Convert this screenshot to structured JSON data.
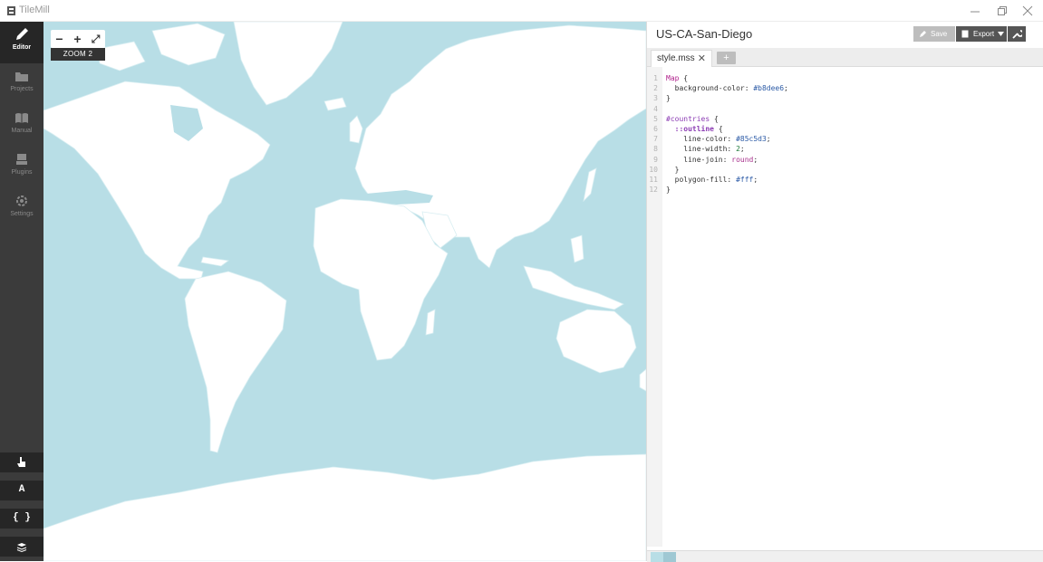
{
  "window": {
    "title": "TileMill",
    "controls": [
      "minimize",
      "maximize",
      "close"
    ]
  },
  "sidebar": {
    "items": [
      {
        "label": "Editor",
        "icon": "pencil-icon",
        "active": true
      },
      {
        "label": "Projects",
        "icon": "folder-icon",
        "active": false
      },
      {
        "label": "Manual",
        "icon": "book-icon",
        "active": false
      },
      {
        "label": "Plugins",
        "icon": "plugin-icon",
        "active": false
      },
      {
        "label": "Settings",
        "icon": "gear-icon",
        "active": false
      }
    ],
    "tools": [
      {
        "name": "pointer-tool",
        "icon": "hand-pointer-icon",
        "text": ""
      },
      {
        "name": "fonts-tool",
        "icon": "font-icon",
        "text": "A"
      },
      {
        "name": "carto-reference-tool",
        "icon": "braces-icon",
        "text": "{ }"
      },
      {
        "name": "layers-tool",
        "icon": "layers-icon",
        "text": ""
      }
    ]
  },
  "map": {
    "zoom_label": "ZOOM 2",
    "zoom_out_label": "−",
    "zoom_in_label": "+",
    "fullscreen_label": "⤢",
    "background_color": "#b8dee6",
    "land_color": "#ffffff",
    "outline_color": "#85c5d3"
  },
  "editor": {
    "project_title": "US-CA-San-Diego",
    "save_label": "Save",
    "export_label": "Export",
    "tabs": [
      {
        "label": "style.mss",
        "close": "✕"
      }
    ],
    "add_tab_label": "+",
    "code_lines": [
      {
        "n": "1",
        "tokens": [
          {
            "t": "Map",
            "c": "k-sel"
          },
          {
            "t": " {",
            "c": ""
          }
        ]
      },
      {
        "n": "2",
        "tokens": [
          {
            "t": "  background-color: ",
            "c": "k-prop"
          },
          {
            "t": "#b8dee6",
            "c": "k-val"
          },
          {
            "t": ";",
            "c": ""
          }
        ]
      },
      {
        "n": "3",
        "tokens": [
          {
            "t": "}",
            "c": ""
          }
        ]
      },
      {
        "n": "4",
        "tokens": []
      },
      {
        "n": "5",
        "tokens": [
          {
            "t": "#countries",
            "c": "k-id"
          },
          {
            "t": " {",
            "c": ""
          }
        ]
      },
      {
        "n": "6",
        "tokens": [
          {
            "t": "  ",
            "c": ""
          },
          {
            "t": "::outline",
            "c": "k-pseudo"
          },
          {
            "t": " {",
            "c": ""
          }
        ]
      },
      {
        "n": "7",
        "tokens": [
          {
            "t": "    line-color: ",
            "c": "k-prop"
          },
          {
            "t": "#85c5d3",
            "c": "k-val"
          },
          {
            "t": ";",
            "c": ""
          }
        ]
      },
      {
        "n": "8",
        "tokens": [
          {
            "t": "    line-width: ",
            "c": "k-prop"
          },
          {
            "t": "2",
            "c": "k-num"
          },
          {
            "t": ";",
            "c": ""
          }
        ]
      },
      {
        "n": "9",
        "tokens": [
          {
            "t": "    line-join: ",
            "c": "k-prop"
          },
          {
            "t": "round",
            "c": "k-kw"
          },
          {
            "t": ";",
            "c": ""
          }
        ]
      },
      {
        "n": "10",
        "tokens": [
          {
            "t": "  }",
            "c": ""
          }
        ]
      },
      {
        "n": "11",
        "tokens": [
          {
            "t": "  polygon-fill: ",
            "c": "k-prop"
          },
          {
            "t": "#fff",
            "c": "k-val"
          },
          {
            "t": ";",
            "c": ""
          }
        ]
      },
      {
        "n": "12",
        "tokens": [
          {
            "t": "}",
            "c": ""
          }
        ]
      }
    ]
  }
}
